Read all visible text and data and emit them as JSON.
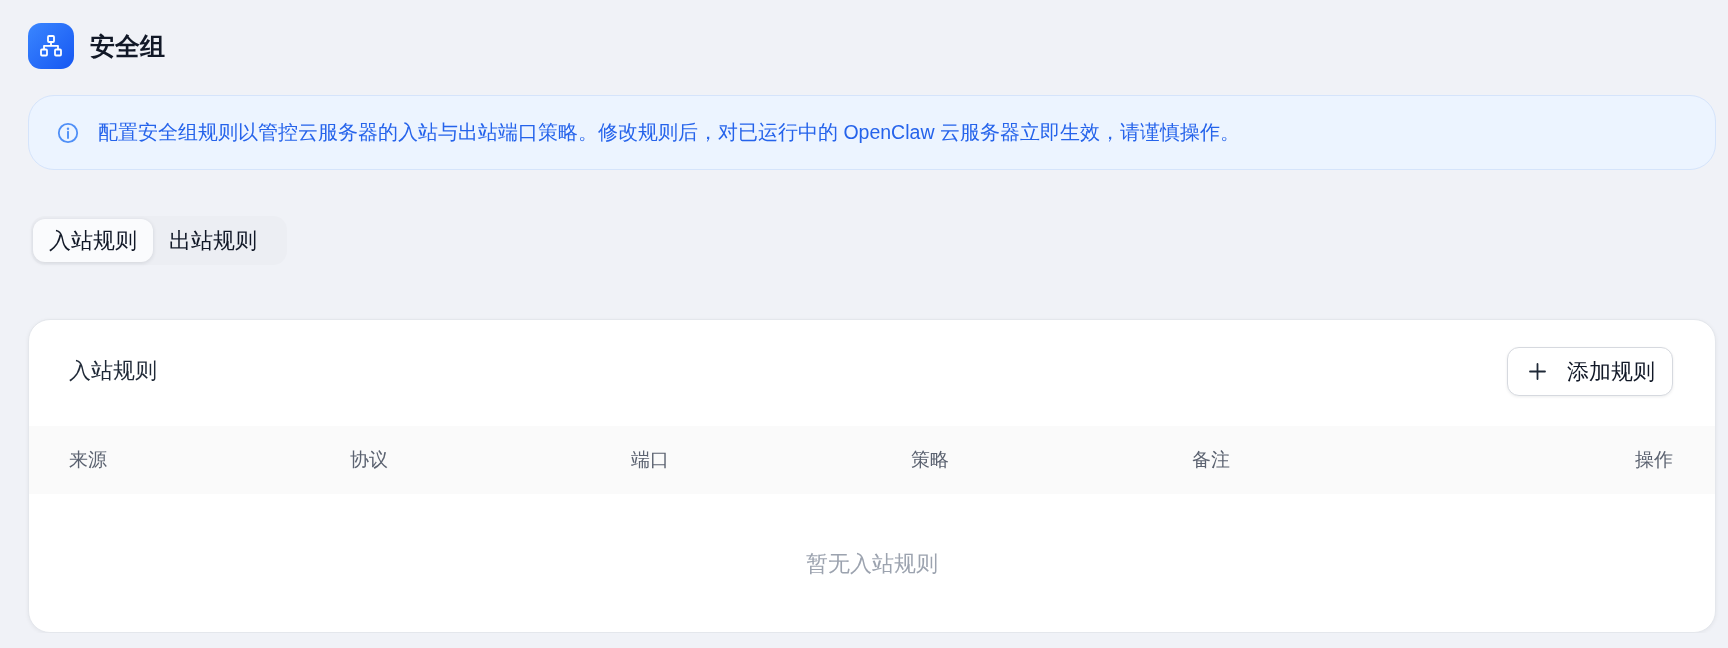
{
  "header": {
    "title": "安全组"
  },
  "notice": {
    "text": "配置安全组规则以管控云服务器的入站与出站端口策略。修改规则后，对已运行中的 OpenClaw 云服务器立即生效，请谨慎操作。"
  },
  "tabs": [
    {
      "label": "入站规则",
      "selected": true
    },
    {
      "label": "出站规则",
      "selected": false
    }
  ],
  "rules_card": {
    "title": "入站规则",
    "add_button": {
      "label": "添加规则"
    },
    "table": {
      "columns": [
        "来源",
        "协议",
        "端口",
        "策略",
        "备注",
        "操作"
      ],
      "empty_text": "暂无入站规则"
    }
  }
}
